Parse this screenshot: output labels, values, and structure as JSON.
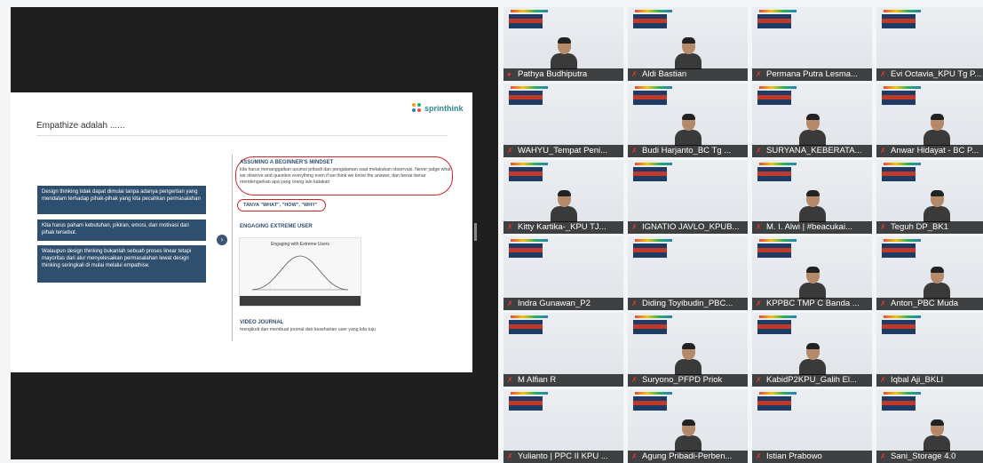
{
  "slide": {
    "title": "Empathize adalah ......",
    "logo_text": "sprinthink",
    "left_boxes": [
      "Design thinking tidak dapat dimulai tanpa adanya pengertian yang mendalam terhadap pihak-pihak yang kita pecahkan permasalahan",
      "Kita harus paham kebutuhan, pikiran, emosi, dan motivasi dari pihak tersebut.",
      "Walaupun design thinking bukanlah sebuah proses linear tetapi mayoritas dari alur menyelesaikan permasalahan lewat design thinking seringkali di mulai melalui empathise."
    ],
    "mindset_heading": "ASSUMING A BEGINNER'S MINDSET",
    "mindset_text": "kita harus menanggalkan asumsi pribadi dan pengalaman saat melakukan observasi. Never judge what we observe and question everything even if we think we know the answer, dan benar-benar mendengarkan apa yang orang lain katakan",
    "ask_label": "TANYA \"WHAT\", \"HOW\", \"WHY\"",
    "engaging_heading": "ENGAGING EXTREME USER",
    "chart_title": "Engaging with Extreme Users",
    "journal_heading": "VIDEO JOURNAL",
    "journal_text": "mengikuti dan membuat journal dari keseharian user yang kita tuju"
  },
  "participants": [
    {
      "name": "Pathya Budhiputra",
      "active": true,
      "muted": false,
      "camera": true
    },
    {
      "name": "Aldi Bastian",
      "muted": true,
      "camera": true
    },
    {
      "name": "Permana Putra Lesma...",
      "muted": true,
      "camera": false
    },
    {
      "name": "Evi Octavia_KPU Tg P...",
      "muted": true,
      "camera": false
    },
    {
      "name": "WAHYU_Tempat Peni...",
      "muted": true,
      "camera": false
    },
    {
      "name": "Budi Harjanto_BC Tg ...",
      "muted": true,
      "camera": true
    },
    {
      "name": "SURYANA_KEBERATA...",
      "muted": true,
      "camera": true
    },
    {
      "name": "Anwar Hidayat - BC P...",
      "muted": true,
      "camera": true
    },
    {
      "name": "Kitty Kartika-_KPU TJ...",
      "muted": true,
      "camera": true
    },
    {
      "name": "IGNATIO JAVLO_KPUB...",
      "muted": true,
      "camera": false
    },
    {
      "name": "M. I. Alwi | #beacukai...",
      "muted": true,
      "camera": true
    },
    {
      "name": "Teguh DP_BK1",
      "muted": true,
      "camera": true
    },
    {
      "name": "Indra Gunawan_P2",
      "muted": true,
      "camera": false
    },
    {
      "name": "Diding Toyibudin_PBC...",
      "muted": true,
      "camera": false
    },
    {
      "name": "KPPBC TMP C Banda ...",
      "muted": true,
      "camera": true
    },
    {
      "name": "Anton_PBC Muda",
      "muted": true,
      "camera": true
    },
    {
      "name": "M Alfian R",
      "muted": true,
      "camera": false
    },
    {
      "name": "Suryono_PFPD Priok",
      "muted": true,
      "camera": true
    },
    {
      "name": "KabidP2KPU_Galih El...",
      "muted": true,
      "camera": true
    },
    {
      "name": "Iqbal Aji_BKLI",
      "muted": true,
      "camera": false
    },
    {
      "name": "Yulianto | PPC II KPU ...",
      "muted": true,
      "camera": false
    },
    {
      "name": "Agung Pribadi-Perben...",
      "muted": true,
      "camera": true
    },
    {
      "name": "Istian Prabowo",
      "muted": true,
      "camera": false
    },
    {
      "name": "Sani_Storage 4.0",
      "muted": true,
      "camera": true
    }
  ],
  "colors": {
    "accent": "#d4e157",
    "slide_box": "#2f4f6f",
    "highlight": "#d2232a",
    "mic_muted": "#e53935"
  }
}
